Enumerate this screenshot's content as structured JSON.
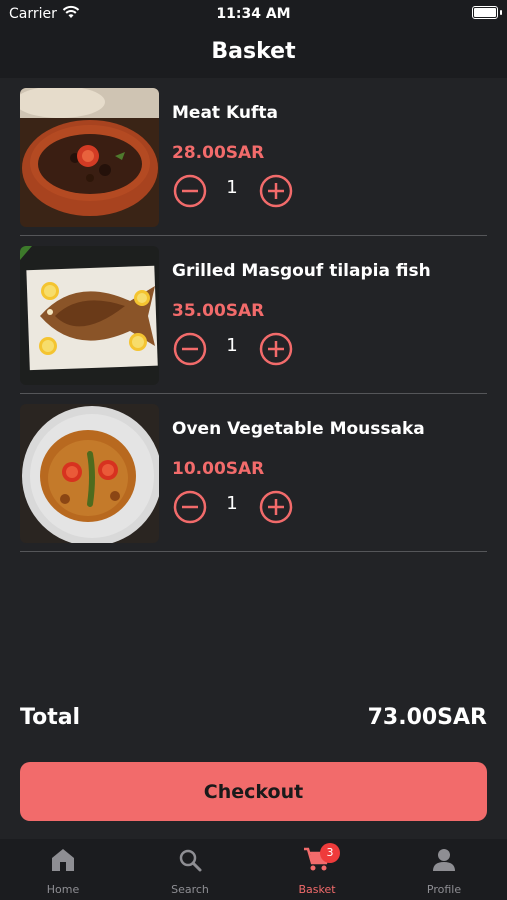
{
  "status_bar": {
    "carrier": "Carrier",
    "time": "11:34 AM"
  },
  "nav": {
    "title": "Basket"
  },
  "items": [
    {
      "name": "Meat Kufta",
      "price": "28.00SAR",
      "qty": "1",
      "image": "meat-kufta-photo"
    },
    {
      "name": "Grilled Masgouf tilapia fish",
      "price": "35.00SAR",
      "qty": "1",
      "image": "grilled-fish-photo"
    },
    {
      "name": "Oven Vegetable Moussaka",
      "price": "10.00SAR",
      "qty": "1",
      "image": "moussaka-photo"
    }
  ],
  "summary": {
    "total_label": "Total",
    "total_value": "73.00SAR"
  },
  "checkout_label": "Checkout",
  "tabs": [
    {
      "label": "Home",
      "icon": "home-icon",
      "active": false
    },
    {
      "label": "Search",
      "icon": "search-icon",
      "active": false
    },
    {
      "label": "Basket",
      "icon": "cart-icon",
      "active": true,
      "badge": "3"
    },
    {
      "label": "Profile",
      "icon": "person-icon",
      "active": false
    }
  ],
  "colors": {
    "accent": "#f26b6b",
    "background": "#222326",
    "bar": "#1b1c1f",
    "badge": "#ef3b3b"
  }
}
